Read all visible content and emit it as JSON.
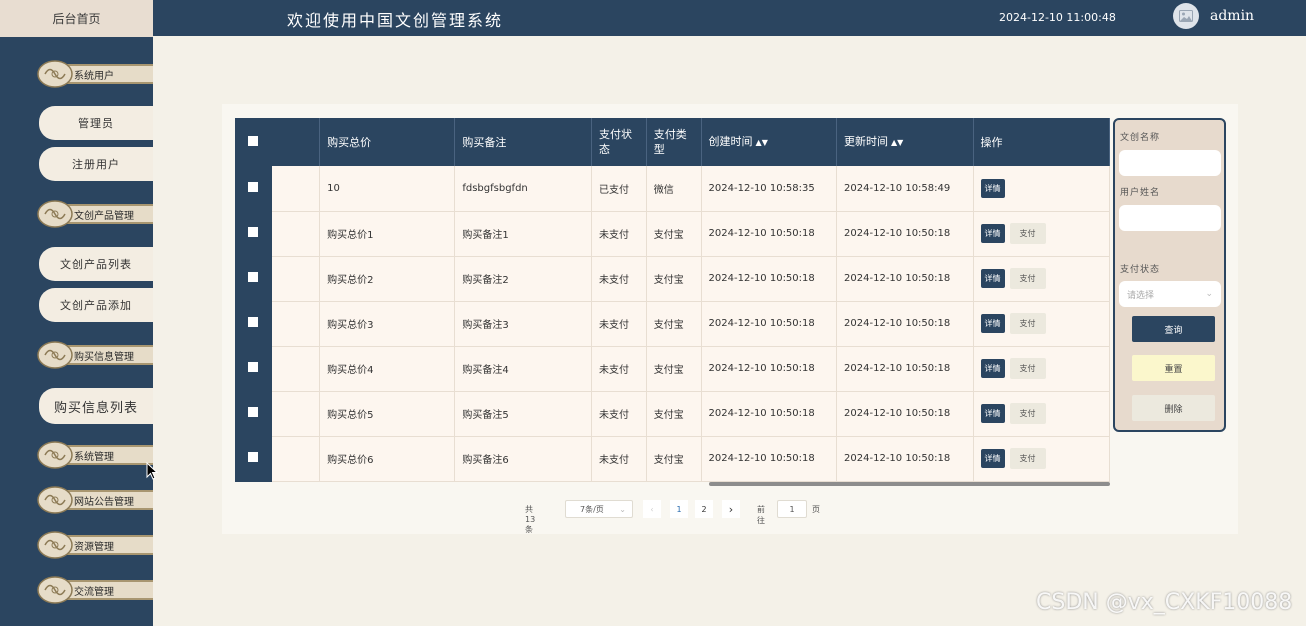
{
  "header": {
    "home_tab": "后台首页",
    "title": "欢迎使用中国文创管理系统",
    "datetime": "2024-12-10 11:00:48",
    "username": "admin"
  },
  "sidebar": {
    "menus": [
      {
        "label": "系统用户"
      },
      {
        "label": "文创产品管理"
      },
      {
        "label": "购买信息管理"
      },
      {
        "label": "系统管理"
      },
      {
        "label": "网站公告管理"
      },
      {
        "label": "资源管理"
      },
      {
        "label": "交流管理"
      }
    ],
    "subitems": [
      {
        "label": "管理员"
      },
      {
        "label": "注册用户"
      },
      {
        "label": "文创产品列表"
      },
      {
        "label": "文创产品添加"
      },
      {
        "label": "购买信息列表"
      }
    ]
  },
  "table": {
    "headers": {
      "total_price": "购买总价",
      "remark": "购买备注",
      "pay_status": "支付状态",
      "pay_type": "支付类型",
      "created": "创建时间",
      "updated": "更新时间",
      "actions": "操作"
    },
    "sort_icon": "sort-icon",
    "detail_label": "详情",
    "pay_label": "支付",
    "rows": [
      {
        "total": "10",
        "remark": "fdsbgfsbgfdn",
        "status": "已支付",
        "type": "微信",
        "created": "2024-12-10 10:58:35",
        "updated": "2024-12-10 10:58:49"
      },
      {
        "total": "购买总价1",
        "remark": "购买备注1",
        "status": "未支付",
        "type": "支付宝",
        "created": "2024-12-10 10:50:18",
        "updated": "2024-12-10 10:50:18"
      },
      {
        "total": "购买总价2",
        "remark": "购买备注2",
        "status": "未支付",
        "type": "支付宝",
        "created": "2024-12-10 10:50:18",
        "updated": "2024-12-10 10:50:18"
      },
      {
        "total": "购买总价3",
        "remark": "购买备注3",
        "status": "未支付",
        "type": "支付宝",
        "created": "2024-12-10 10:50:18",
        "updated": "2024-12-10 10:50:18"
      },
      {
        "total": "购买总价4",
        "remark": "购买备注4",
        "status": "未支付",
        "type": "支付宝",
        "created": "2024-12-10 10:50:18",
        "updated": "2024-12-10 10:50:18"
      },
      {
        "total": "购买总价5",
        "remark": "购买备注5",
        "status": "未支付",
        "type": "支付宝",
        "created": "2024-12-10 10:50:18",
        "updated": "2024-12-10 10:50:18"
      },
      {
        "total": "购买总价6",
        "remark": "购买备注6",
        "status": "未支付",
        "type": "支付宝",
        "created": "2024-12-10 10:50:18",
        "updated": "2024-12-10 10:50:18"
      }
    ]
  },
  "pagination": {
    "total": "共 13 条",
    "page_size": "7条/页",
    "pages": [
      "1",
      "2"
    ],
    "current_page": "1",
    "goto_label": "前往",
    "goto_value": "1",
    "goto_suffix": "页"
  },
  "search": {
    "name_label": "文创名称",
    "user_label": "用户姓名",
    "status_label": "支付状态",
    "status_placeholder": "请选择",
    "query_button": "查询",
    "reset_button": "重置",
    "delete_button": "删除"
  },
  "watermark": "CSDN @vx_CXKF10088",
  "colors": {
    "primary": "#2b4560",
    "background": "#f4f1e8",
    "row_bg": "#fdf6ef",
    "reset_bg": "#fbf7cc",
    "delete_bg": "#ece9de"
  }
}
